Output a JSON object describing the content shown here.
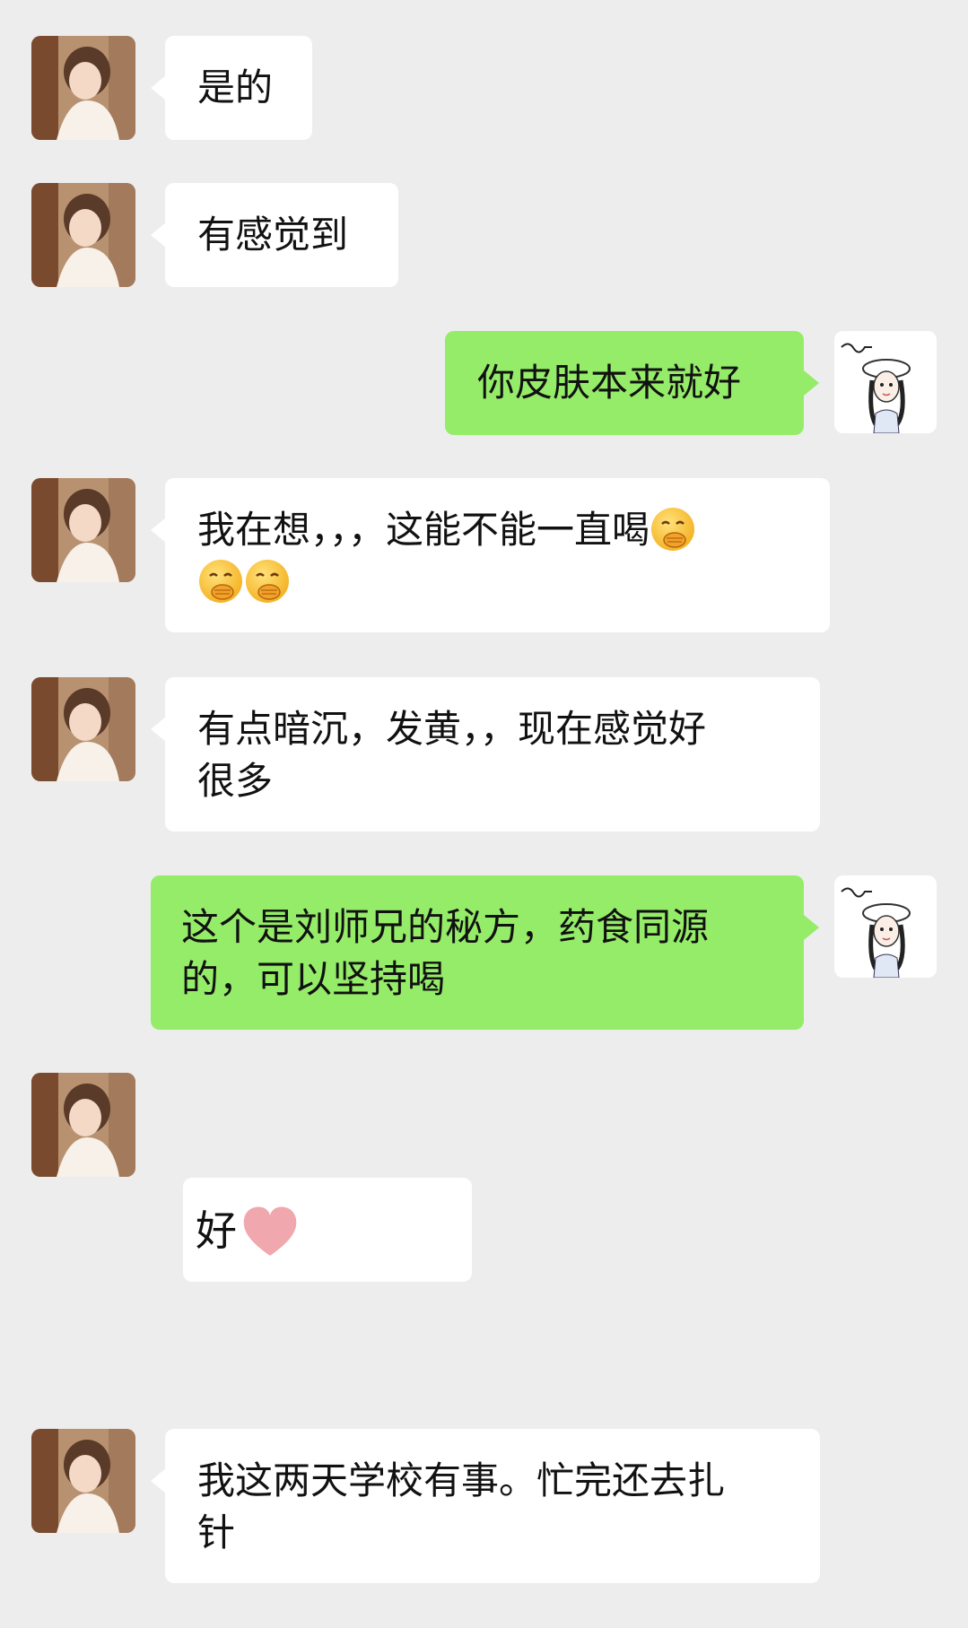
{
  "messages": [
    {
      "side": "in",
      "text": "是的"
    },
    {
      "side": "in",
      "text": "有感觉到"
    },
    {
      "side": "out",
      "text": "你皮肤本来就好"
    },
    {
      "side": "in",
      "line1": "我在想，，，这能不能一直喝",
      "emoji": "face-with-hand-over-mouth-icon"
    },
    {
      "side": "in",
      "line1": "有点暗沉，发黄，，现在感觉好",
      "line2": "很多"
    },
    {
      "side": "out",
      "line1": "这个是刘师兄的秘方，药食同源",
      "line2": "的，可以坚持喝"
    },
    {
      "side": "in",
      "text": "好",
      "emoji": "pink-heart-icon"
    },
    {
      "side": "in",
      "line1": "我这两天学校有事。忙完还去扎",
      "line2": "针"
    }
  ],
  "colors": {
    "background": "#ededed",
    "incoming_bubble": "#ffffff",
    "outgoing_bubble": "#95ec69"
  }
}
